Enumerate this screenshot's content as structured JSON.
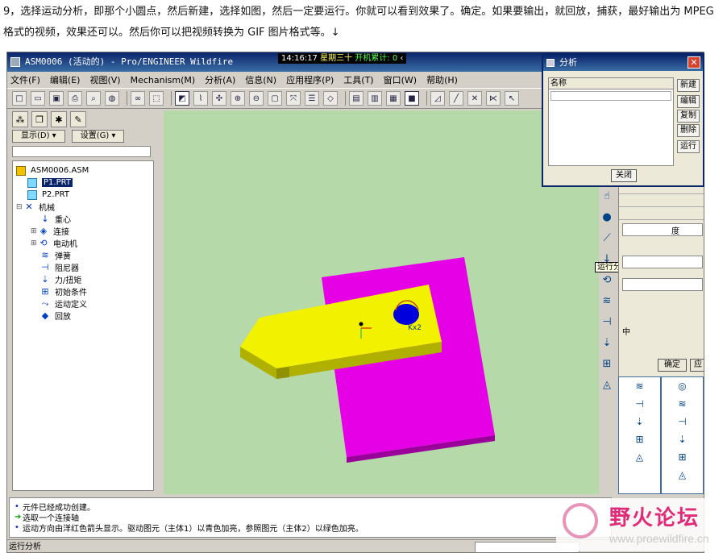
{
  "article": {
    "text": "9，选择运动分析，即那个小圆点，然后新建，选择如图，然后一定要运行。你就可以看到效果了。确定。如果要输出，就回放，捕获，最好输出为 MPEG 格式的视频，效果还可以。然后你可以把视频转换为 GIF 图片格式等。↓"
  },
  "window": {
    "title": "ASM0006 (活动的) - Pro/ENGINEER Wildfire",
    "clock": "14:16:17",
    "weekday": "星期三十",
    "uptime": "开机累计: 0",
    "clock_ctrl": "‹"
  },
  "menu": [
    "文件(F)",
    "编辑(E)",
    "视图(V)",
    "Mechanism(M)",
    "分析(A)",
    "信息(N)",
    "应用程序(P)",
    "工具(T)",
    "窗口(W)",
    "帮助(H)"
  ],
  "toolbar": {
    "icons": [
      "new-file-icon",
      "open-folder-icon",
      "save-icon",
      "print-icon",
      "print-preview-icon",
      "render-icon",
      "binoculars-icon",
      "select-box-icon",
      "sketch-icon",
      "datum-icon",
      "spin-icon",
      "zoom-in-icon",
      "zoom-out-icon",
      "refit-icon",
      "orient-icon",
      "view-list-icon",
      "layers-icon",
      "wireframe-icon",
      "hidden-line-icon",
      "no-hidden-icon",
      "shaded-icon",
      "datum-plane-icon",
      "datum-axis-icon",
      "datum-point-icon",
      "coord-sys-icon",
      "cursor-icon"
    ]
  },
  "left_panel": {
    "display_btn": "显示(D) ▾",
    "settings_btn": "设置(G) ▾",
    "tree": [
      {
        "label": "ASM0006.ASM",
        "type": "asm",
        "indent": 0
      },
      {
        "label": "P1.PRT",
        "type": "part",
        "indent": 1,
        "selected": true
      },
      {
        "label": "P2.PRT",
        "type": "part",
        "indent": 1
      },
      {
        "label": "机械",
        "type": "mech",
        "indent": 0,
        "expander": "⊟"
      },
      {
        "label": "重心",
        "type": "blue",
        "indent": 2
      },
      {
        "label": "连接",
        "type": "blue",
        "indent": 2,
        "expander": "⊞"
      },
      {
        "label": "电动机",
        "type": "blue",
        "indent": 2,
        "expander": "⊞"
      },
      {
        "label": "弹簧",
        "type": "blue",
        "indent": 2
      },
      {
        "label": "阻尼器",
        "type": "blue",
        "indent": 2
      },
      {
        "label": "力/扭矩",
        "type": "blue",
        "indent": 2
      },
      {
        "label": "初始条件",
        "type": "blue",
        "indent": 2
      },
      {
        "label": "运动定义",
        "type": "blue",
        "indent": 2
      },
      {
        "label": "回放",
        "type": "blue",
        "indent": 2
      }
    ]
  },
  "viewport": {
    "annotation": "Kx2",
    "colors": {
      "bg": "#b5d9a8",
      "plate": "#e600e6",
      "part": "#f2f200",
      "marker": "#0000cc"
    }
  },
  "tooltip": "运行分析",
  "background_panel": {
    "unit": "度",
    "middle": "中",
    "ok": "确定",
    "apply": "应"
  },
  "messages": [
    {
      "kind": "bullet",
      "text": "元件已经成功创建。"
    },
    {
      "kind": "arrow",
      "text": "选取一个连接轴"
    },
    {
      "kind": "bullet",
      "text": "运动方向由洋红色箭头显示。驱动图元（主体1）以青色加亮，参照图元（主体2）以绿色加亮。"
    }
  ],
  "status": "运行分析",
  "dialog": {
    "title": "分析",
    "list_header": "名称",
    "buttons": [
      "新建",
      "编辑",
      "复制",
      "删除",
      "运行"
    ],
    "close": "关闭"
  },
  "watermark": {
    "title": "野火论坛",
    "url": "www.proewildfire.cn"
  }
}
